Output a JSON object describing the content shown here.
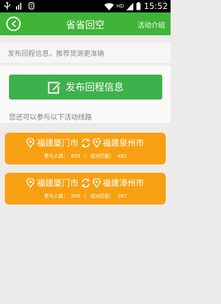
{
  "status_bar": {
    "left_icons": [
      "usb-icon",
      "signal-bars-icon",
      "usb-debug-icon"
    ],
    "right_icons": [
      "wifi-icon",
      "hd-signal-icon",
      "battery-icon"
    ],
    "hd_label": "HD",
    "time": "15:52"
  },
  "header": {
    "title": "省省回空",
    "right_link": "活动介绍",
    "back_icon": "chevron-left-icon",
    "background": "#3fb437"
  },
  "info": {
    "text": "发布回程信息，推荐货源更准确"
  },
  "publish": {
    "label": "发布回程信息",
    "icon": "edit-icon",
    "color": "#3fb14c"
  },
  "hint": "您还可以参与以下活动线路",
  "routes": [
    {
      "from": "福建厦门市",
      "to": "福建泉州市",
      "participants_label": "参与人数：",
      "participants": "603",
      "separator": "|",
      "success_label": "成功匹配：",
      "success": "482"
    },
    {
      "from": "福建厦门市",
      "to": "福建漳州市",
      "participants_label": "参与人数：",
      "participants": "209",
      "separator": "|",
      "success_label": "成功匹配：",
      "success": "167"
    }
  ],
  "colors": {
    "route_card": "#f7a012",
    "background": "#ecebe9"
  }
}
